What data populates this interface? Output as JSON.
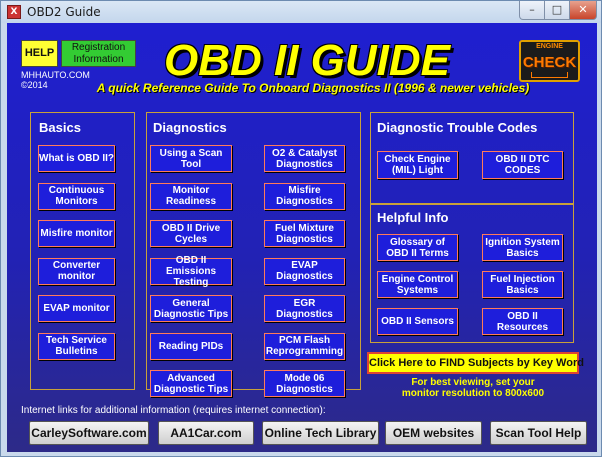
{
  "window": {
    "title": "OBD2 Guide",
    "app_icon_glyph": "X",
    "min_glyph": "–",
    "max_glyph": "□",
    "close_glyph": "✕"
  },
  "header": {
    "help_label": "HELP",
    "registration_label": "Registration Information",
    "publisher": "MHHAUTO.COM",
    "year": "©2014",
    "main_title": "OBD II GUIDE",
    "subtitle": "A quick Reference Guide To Onboard Diagnostics II (1996 & newer vehicles)",
    "check_engine_label": "CHECK",
    "check_engine_top": "ENGINE"
  },
  "basics": {
    "title": "Basics",
    "items": [
      "What is OBD II?",
      "Continuous Monitors",
      "Misfire monitor",
      "Converter monitor",
      "EVAP monitor",
      "Tech Service Bulletins"
    ]
  },
  "diagnostics": {
    "title": "Diagnostics",
    "left": [
      "Using a Scan Tool",
      "Monitor Readiness",
      "OBD II Drive Cycles",
      "OBD II Emissions Testing",
      "General Diagnostic Tips",
      "Reading PIDs",
      "Advanced Diagnostic Tips"
    ],
    "right": [
      "O2 & Catalyst Diagnostics",
      "Misfire Diagnostics",
      "Fuel Mixture Diagnostics",
      "EVAP Diagnostics",
      "EGR Diagnostics",
      "PCM Flash Reprogramming",
      "Mode 06 Diagnostics"
    ]
  },
  "dtc": {
    "title": "Diagnostic Trouble Codes",
    "items": [
      "Check Engine (MIL) Light",
      "OBD II DTC CODES"
    ]
  },
  "helpful": {
    "title": "Helpful Info",
    "items": [
      "Glossary of OBD II Terms",
      "Ignition System Basics",
      "Engine Control Systems",
      "Fuel Injection Basics",
      "OBD II Sensors",
      "OBD II Resources"
    ]
  },
  "find": {
    "button_label": "Click Here to FIND Subjects by Key Word",
    "note_line1": "For best viewing, set your",
    "note_line2": "monitor resolution to 800x600"
  },
  "links": {
    "caption": "Internet links for additional information (requires internet connection):",
    "buttons": [
      "CarleySoftware.com",
      "AA1Car.com",
      "Online Tech Library",
      "OEM websites",
      "Scan Tool Help"
    ]
  },
  "colors": {
    "accent_yellow": "#ffff00",
    "button_blue": "#1e1edb",
    "button_border": "#ff7a5a",
    "panel_border": "#c9a13a",
    "help_yellow": "#ffff33",
    "registration_green": "#33cc33"
  }
}
